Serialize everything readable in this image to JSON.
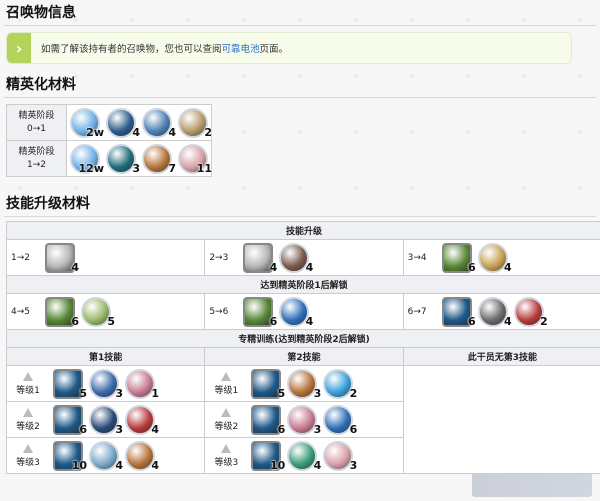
{
  "summon": {
    "title": "召唤物信息",
    "notice_prefix": "如需了解该持有者的召唤物，您也可以查阅",
    "notice_link": "可靠电池",
    "notice_suffix": "页面。"
  },
  "elite": {
    "title": "精英化材料",
    "rows": [
      {
        "label1": "精英阶段",
        "label2": "0→1",
        "items": [
          {
            "icon": "lmd-chip-icon",
            "count": "2w",
            "color": "#6fb0e8"
          },
          {
            "icon": "specialist-chip-icon",
            "count": "4",
            "color": "#2b5c8a"
          },
          {
            "icon": "device-icon",
            "count": "4",
            "color": "#4d7fb5"
          },
          {
            "icon": "polyester-icon",
            "count": "2",
            "color": "#b59a6a"
          }
        ]
      },
      {
        "label1": "精英阶段",
        "label2": "1→2",
        "items": [
          {
            "icon": "lmd-chip-icon",
            "count": "12w",
            "color": "#6fb0e8"
          },
          {
            "icon": "dualchip-icon",
            "count": "3",
            "color": "#1d6b7a"
          },
          {
            "icon": "crystal-box-icon",
            "count": "7",
            "color": "#b5733a"
          },
          {
            "icon": "pink-block-icon",
            "count": "11",
            "color": "#d8a0a8"
          }
        ]
      }
    ]
  },
  "skill": {
    "title": "技能升级材料",
    "upgrade_header": "技能升级",
    "unlock1_header": "达到精英阶段1后解锁",
    "mastery_header": "专精训练(达到精英阶段2后解锁)",
    "col1": "第1技能",
    "col2": "第2技能",
    "col3": "此干员无第3技能",
    "upgrades": [
      {
        "step": "1→2",
        "items": [
          {
            "icon": "skill-summary-icon",
            "count": "4",
            "color": "#b8b8b8",
            "square": true
          }
        ]
      },
      {
        "step": "2→3",
        "items": [
          {
            "icon": "skill-summary-icon",
            "count": "4",
            "color": "#b8b8b8",
            "square": true
          },
          {
            "icon": "rock-icon",
            "count": "4",
            "color": "#7a5a4a"
          }
        ]
      },
      {
        "step": "3→4",
        "items": [
          {
            "icon": "skill-summary-2-icon",
            "count": "6",
            "color": "#5a8a3a",
            "square": true
          },
          {
            "icon": "gold-ore-icon",
            "count": "4",
            "color": "#c8a050"
          }
        ]
      },
      {
        "step": "4→5",
        "items": [
          {
            "icon": "skill-summary-2-icon",
            "count": "6",
            "color": "#5a8a3a",
            "square": true
          },
          {
            "icon": "grass-ore-icon",
            "count": "5",
            "color": "#9ab86a"
          }
        ]
      },
      {
        "step": "5→6",
        "items": [
          {
            "icon": "skill-summary-2-icon",
            "count": "6",
            "color": "#5a8a3a",
            "square": true
          },
          {
            "icon": "blue-cube-icon",
            "count": "4",
            "color": "#2f6fb8"
          }
        ]
      },
      {
        "step": "6→7",
        "items": [
          {
            "icon": "skill-summary-3-icon",
            "count": "6",
            "color": "#1f5a8a",
            "square": true
          },
          {
            "icon": "blade-icon",
            "count": "4",
            "color": "#6a6a6a"
          },
          {
            "icon": "red-cube-icon",
            "count": "2",
            "color": "#b83a3a"
          }
        ]
      }
    ],
    "mastery_label": "等级",
    "mastery": [
      {
        "lvl": "1",
        "s1": [
          {
            "icon": "skill-summary-3-icon",
            "count": "5",
            "color": "#1f5a8a",
            "square": true
          },
          {
            "icon": "crystal-shard-icon",
            "count": "3",
            "color": "#3a6aa8"
          },
          {
            "icon": "pink-crystal-icon",
            "count": "1",
            "color": "#c87a90"
          }
        ],
        "s2": [
          {
            "icon": "skill-summary-3-icon",
            "count": "5",
            "color": "#1f5a8a",
            "square": true
          },
          {
            "icon": "crystal-box-icon",
            "count": "3",
            "color": "#b5733a"
          },
          {
            "icon": "blue-orb-icon",
            "count": "2",
            "color": "#3aa0d8"
          }
        ]
      },
      {
        "lvl": "2",
        "s1": [
          {
            "icon": "skill-summary-3-icon",
            "count": "6",
            "color": "#1f5a8a",
            "square": true
          },
          {
            "icon": "chip-box-icon",
            "count": "3",
            "color": "#2b4a7a"
          },
          {
            "icon": "red-cube-icon",
            "count": "4",
            "color": "#b83a3a"
          }
        ],
        "s2": [
          {
            "icon": "skill-summary-3-icon",
            "count": "6",
            "color": "#1f5a8a",
            "square": true
          },
          {
            "icon": "pink-crystal-icon",
            "count": "3",
            "color": "#c87a90"
          },
          {
            "icon": "blue-cube-icon",
            "count": "6",
            "color": "#2f6fb8"
          }
        ]
      },
      {
        "lvl": "3",
        "s1": [
          {
            "icon": "skill-summary-3-icon",
            "count": "10",
            "color": "#1f5a8a",
            "square": true
          },
          {
            "icon": "orb-cluster-icon",
            "count": "4",
            "color": "#7aa8c8"
          },
          {
            "icon": "crystal-box-icon",
            "count": "4",
            "color": "#b5733a"
          }
        ],
        "s2": [
          {
            "icon": "skill-summary-3-icon",
            "count": "10",
            "color": "#1f5a8a",
            "square": true
          },
          {
            "icon": "green-orb-icon",
            "count": "4",
            "color": "#3a9a7a"
          },
          {
            "icon": "pink-block-icon",
            "count": "3",
            "color": "#d8a0a8"
          }
        ]
      }
    ]
  }
}
